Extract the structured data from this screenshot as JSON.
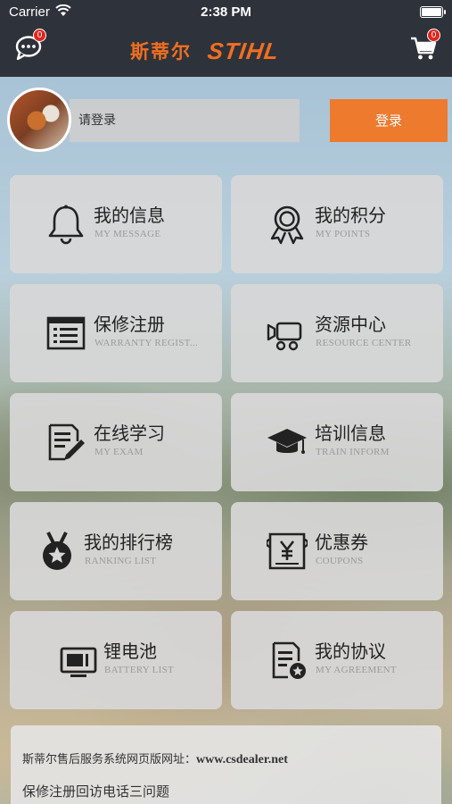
{
  "status_bar": {
    "carrier": "Carrier",
    "time": "2:38 PM"
  },
  "header": {
    "brand_cn": "斯蒂尔",
    "brand_logo": "STIHL",
    "brand_color": "#f06f1f",
    "message_badge": "0",
    "cart_badge": "0",
    "bar_color": "#2e323b"
  },
  "login": {
    "placeholder": "请登录",
    "button_label": "登录",
    "button_color": "#ee7a2e"
  },
  "menu": [
    {
      "title": "我的信息",
      "subtitle": "MY MESSAGE",
      "icon": "bell-icon"
    },
    {
      "title": "我的积分",
      "subtitle": "MY POINTS",
      "icon": "medal-icon"
    },
    {
      "title": "保修注册",
      "subtitle": "WARRANTY REGIST...",
      "icon": "form-window-icon"
    },
    {
      "title": "资源中心",
      "subtitle": "RESOURCE CENTER",
      "icon": "camera-resource-icon"
    },
    {
      "title": "在线学习",
      "subtitle": "MY EXAM",
      "icon": "exam-paper-icon"
    },
    {
      "title": "培训信息",
      "subtitle": "TRAIN INFORM",
      "icon": "graduation-cap-icon"
    },
    {
      "title": "我的排行榜",
      "subtitle": "RANKING LIST",
      "icon": "ranking-medal-icon"
    },
    {
      "title": "优惠券",
      "subtitle": "COUPONS",
      "icon": "coupon-icon"
    },
    {
      "title": "锂电池",
      "subtitle": "BATTERY LIST",
      "icon": "battery-monitor-icon"
    },
    {
      "title": "我的协议",
      "subtitle": "MY AGREEMENT",
      "icon": "agreement-icon"
    }
  ],
  "footer": {
    "website_label": "斯蒂尔售后服务系统网页版网址：",
    "website_url": "www.csdealer.net",
    "warranty_link": "保修注册回访电话三问题"
  }
}
